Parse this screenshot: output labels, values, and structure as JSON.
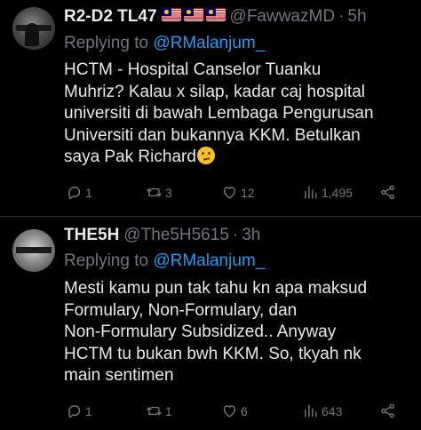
{
  "tweets": [
    {
      "author_name": "R2-D2 TL47",
      "author_flags": [
        "malaysia-flag",
        "malaysia-flag",
        "malaysia-flag"
      ],
      "handle": "@FawwazMD",
      "separator": "·",
      "time": "5h",
      "replying_prefix": "Replying to",
      "replying_to": "@RMalanjum_",
      "body_lines": [
        "HCTM - Hospital Canselor Tuanku",
        "Muhriz? Kalau x silap, kadar caj hospital",
        "universiti di bawah Lembaga Pengurusan",
        "Universiti dan bukannya KKM. Betulkan",
        "saya Pak Richard"
      ],
      "body_emoji": "thinking-face-emoji",
      "replies": "1",
      "reposts": "3",
      "likes": "12",
      "views": "1,495"
    },
    {
      "author_name": "THE5H",
      "handle": "@The5H5615",
      "separator": "·",
      "time": "3h",
      "replying_prefix": "Replying to",
      "replying_to": "@RMalanjum_",
      "body_lines": [
        "Mesti kamu pun tak tahu kn apa maksud",
        "Formulary, Non-Formulary, dan",
        "Non-Formulary Subsidized.. Anyway",
        "HCTM tu bukan bwh KKM. So, tkyah nk",
        "main sentimen"
      ],
      "replies": "1",
      "reposts": "1",
      "likes": "6",
      "views": "643"
    }
  ],
  "colors": {
    "background": "#000000",
    "text": "#e7e9ea",
    "muted": "#71767b",
    "accent": "#1d9bf0",
    "divider": "#2f3336"
  },
  "icons": {
    "reply": "reply-icon",
    "repost": "repost-icon",
    "like": "heart-icon",
    "views": "views-icon",
    "share": "share-icon"
  }
}
